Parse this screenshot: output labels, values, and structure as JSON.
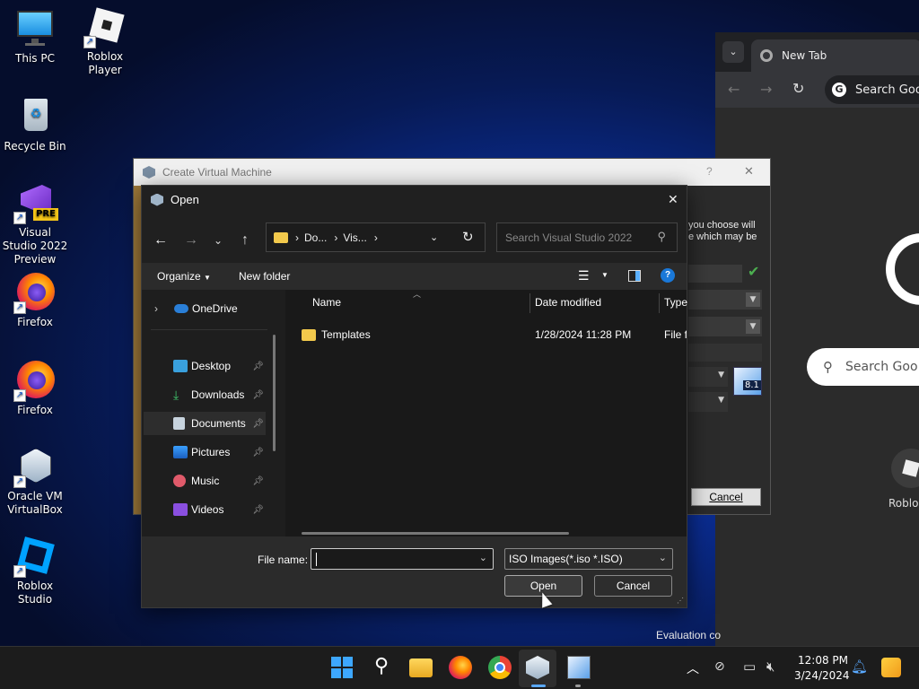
{
  "desktop": {
    "icons": [
      {
        "label": "This PC",
        "icon": "monitor-icon"
      },
      {
        "label": "Roblox Player",
        "icon": "roblox-icon"
      },
      {
        "label": "Recycle Bin",
        "icon": "recycle-bin-icon"
      },
      {
        "label": "Visual Studio 2022 Preview",
        "icon": "visual-studio-icon",
        "badge": "PRE"
      },
      {
        "label": "Firefox",
        "icon": "firefox-icon"
      },
      {
        "label": "Firefox",
        "icon": "firefox-icon"
      },
      {
        "label": "Oracle VM VirtualBox",
        "icon": "virtualbox-icon"
      },
      {
        "label": "Roblox Studio",
        "icon": "roblox-studio-icon"
      }
    ],
    "watermark": "Evaluation co"
  },
  "chrome": {
    "tab_title": "New Tab",
    "address_placeholder": "Search Goo",
    "search_box_placeholder": "Search Goo",
    "shortcut_label": "Roblo",
    "google_letter": "G"
  },
  "vm_window": {
    "title": "Create Virtual Machine",
    "help": "?",
    "close": "✕",
    "text_line1": "you choose will",
    "text_line2": "e which may be",
    "cancel_label": "Cancel",
    "os_badge": "8.1"
  },
  "open_dialog": {
    "title": "Open",
    "close": "✕",
    "breadcrumb": [
      "Do...",
      "Vis..."
    ],
    "search_placeholder": "Search Visual Studio 2022",
    "organize_label": "Organize",
    "new_folder_label": "New folder",
    "help": "?",
    "nav": [
      {
        "label": "OneDrive",
        "icon": "onedrive-icon",
        "pinned": false
      },
      {
        "label": "Desktop",
        "icon": "desktop-folder-icon",
        "pinned": true
      },
      {
        "label": "Downloads",
        "icon": "downloads-icon",
        "pinned": true
      },
      {
        "label": "Documents",
        "icon": "documents-icon",
        "pinned": true,
        "selected": true
      },
      {
        "label": "Pictures",
        "icon": "pictures-icon",
        "pinned": true
      },
      {
        "label": "Music",
        "icon": "music-icon",
        "pinned": true
      },
      {
        "label": "Videos",
        "icon": "videos-icon",
        "pinned": true
      }
    ],
    "columns": [
      "Name",
      "Date modified",
      "Type"
    ],
    "files": [
      {
        "name": "Templates",
        "date": "1/28/2024 11:28 PM",
        "type": "File fo"
      }
    ],
    "file_name_label": "File name:",
    "file_name_value": "",
    "file_type": "ISO Images(*.iso *.ISO)",
    "open_label": "Open",
    "cancel_label": "Cancel"
  },
  "taskbar": {
    "time": "12:08 PM",
    "date": "3/24/2024",
    "apps": [
      "windows-start-icon",
      "search-icon",
      "file-explorer-icon",
      "firefox-icon",
      "chrome-icon",
      "virtualbox-icon",
      "vm-settings-icon"
    ]
  },
  "colors": {
    "accent": "#0078d4",
    "folder": "#f2c94c",
    "selected": "#2d2d2d"
  }
}
